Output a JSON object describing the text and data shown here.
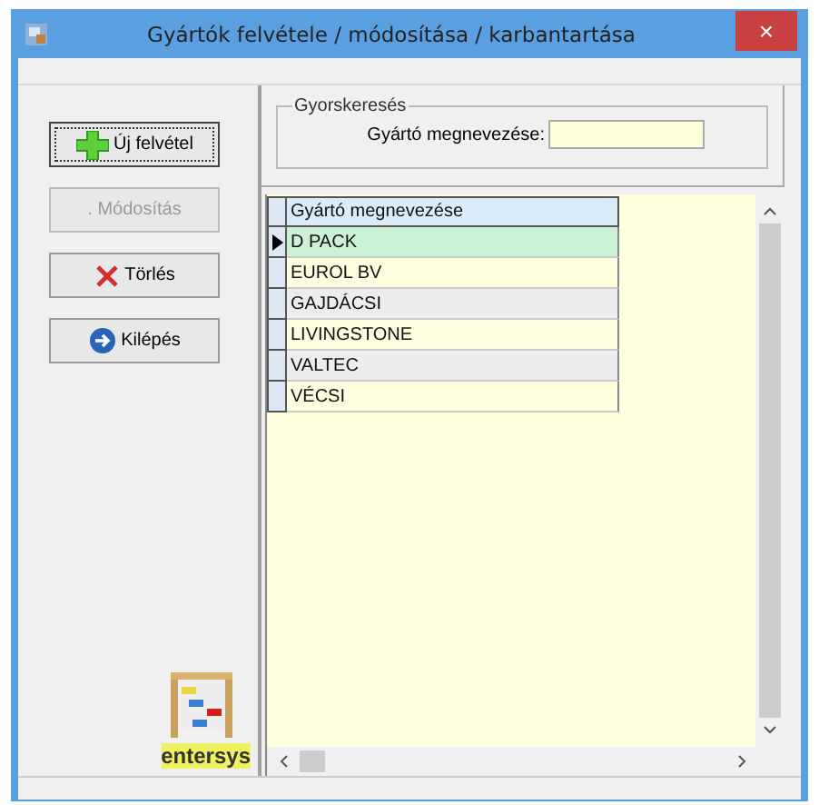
{
  "window": {
    "title": "Gyártók felvétele / módosítása / karbantartása",
    "close": "×"
  },
  "buttons": [
    {
      "label": "Új felvétel",
      "kind": "add",
      "disabled": false,
      "focused": true
    },
    {
      "label": ". Módosítás",
      "kind": "none",
      "disabled": true,
      "focused": false
    },
    {
      "label": "Törlés",
      "kind": "delete",
      "disabled": false,
      "focused": false
    },
    {
      "label": "Kilépés",
      "kind": "exit",
      "disabled": false,
      "focused": false
    }
  ],
  "logo": {
    "text": "entersys"
  },
  "search": {
    "group_title": "Gyorskeresés",
    "label": "Gyártó megnevezése:"
  },
  "table": {
    "columns": [
      "Gyártó megnevezése"
    ],
    "rows": [
      {
        "name": "D PACK",
        "selected": true
      },
      {
        "name": "EUROL BV",
        "selected": false
      },
      {
        "name": "GAJDÁCSI",
        "selected": false
      },
      {
        "name": "LIVINGSTONE",
        "selected": false
      },
      {
        "name": "VALTEC",
        "selected": false
      },
      {
        "name": "VÉCSI",
        "selected": false
      }
    ]
  }
}
